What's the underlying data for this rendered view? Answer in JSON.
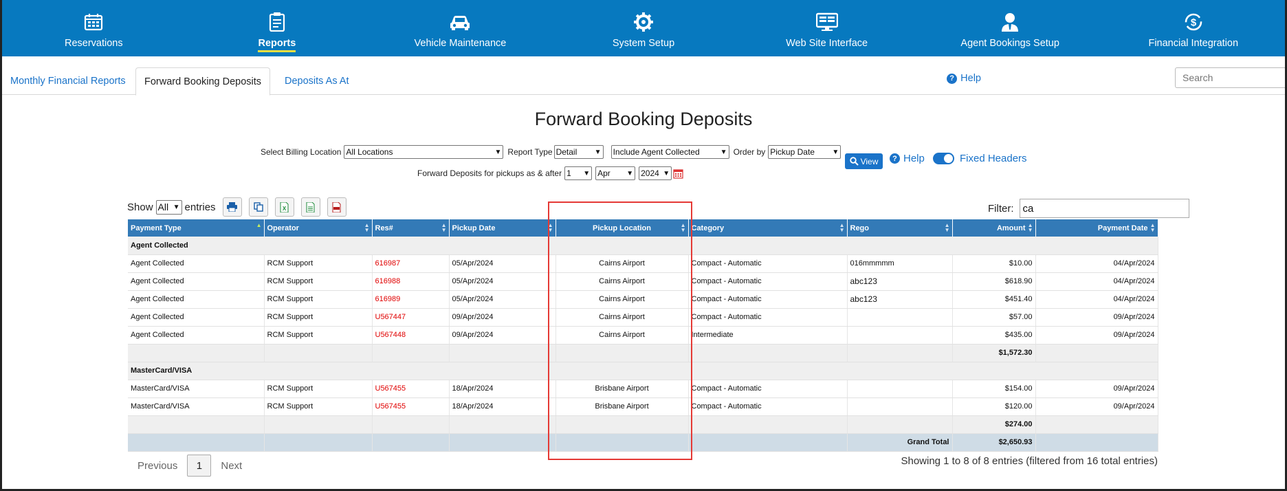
{
  "nav": [
    {
      "label": "Reservations",
      "icon": "calendar-icon",
      "active": false
    },
    {
      "label": "Reports",
      "icon": "report-icon",
      "active": true
    },
    {
      "label": "Vehicle Maintenance",
      "icon": "car-icon",
      "active": false
    },
    {
      "label": "System Setup",
      "icon": "gear-icon",
      "active": false
    },
    {
      "label": "Web Site Interface",
      "icon": "monitor-icon",
      "active": false
    },
    {
      "label": "Agent Bookings Setup",
      "icon": "agent-icon",
      "active": false
    },
    {
      "label": "Financial Integration",
      "icon": "dollar-cycle-icon",
      "active": false
    }
  ],
  "tabs": {
    "monthly": "Monthly Financial Reports",
    "forward": "Forward Booking Deposits",
    "asat": "Deposits As At"
  },
  "help_label": "Help",
  "search_placeholder": "Search",
  "title": "Forward Booking Deposits",
  "controls": {
    "billing_label": "Select Billing Location",
    "billing_value": "All Locations",
    "report_type_label": "Report Type",
    "report_type_value": "Detail",
    "agent_value": "Include Agent Collected",
    "order_label": "Order by",
    "order_value": "Pickup Date",
    "view_label": "View",
    "help_label": "Help",
    "fixed_headers_label": "Fixed Headers",
    "fixed_headers_on": true,
    "pickups_label": "Forward Deposits for pickups as & after",
    "day_value": "1",
    "month_value": "Apr",
    "year_value": "2024"
  },
  "table_tools": {
    "show_label": "Show",
    "show_value": "All",
    "entries_label": "entries",
    "filter_label": "Filter:",
    "filter_value": "ca"
  },
  "columns": [
    "Payment Type",
    "Operator",
    "Res#",
    "Pickup Date",
    "Pickup Location",
    "Category",
    "Rego",
    "Amount",
    "Payment Date"
  ],
  "groups": [
    {
      "name": "Agent Collected",
      "rows": [
        {
          "type": "Agent Collected",
          "operator": "RCM Support",
          "res": "616987",
          "pickup": "05/Apr/2024",
          "location": "Cairns Airport",
          "category": "Compact - Automatic",
          "rego": "016mmmmm",
          "amount": "$10.00",
          "paydate": "04/Apr/2024"
        },
        {
          "type": "Agent Collected",
          "operator": "RCM Support",
          "res": "616988",
          "pickup": "05/Apr/2024",
          "location": "Cairns Airport",
          "category": "Compact - Automatic",
          "rego": "abc123",
          "amount": "$618.90",
          "paydate": "04/Apr/2024"
        },
        {
          "type": "Agent Collected",
          "operator": "RCM Support",
          "res": "616989",
          "pickup": "05/Apr/2024",
          "location": "Cairns Airport",
          "category": "Compact - Automatic",
          "rego": "abc123",
          "amount": "$451.40",
          "paydate": "04/Apr/2024"
        },
        {
          "type": "Agent Collected",
          "operator": "RCM Support",
          "res": "U567447",
          "pickup": "09/Apr/2024",
          "location": "Cairns Airport",
          "category": "Compact - Automatic",
          "rego": "",
          "amount": "$57.00",
          "paydate": "09/Apr/2024"
        },
        {
          "type": "Agent Collected",
          "operator": "RCM Support",
          "res": "U567448",
          "pickup": "09/Apr/2024",
          "location": "Cairns Airport",
          "category": "Intermediate",
          "rego": "",
          "amount": "$435.00",
          "paydate": "09/Apr/2024"
        }
      ],
      "subtotal": "$1,572.30"
    },
    {
      "name": "MasterCard/VISA",
      "rows": [
        {
          "type": "MasterCard/VISA",
          "operator": "RCM Support",
          "res": "U567455",
          "pickup": "18/Apr/2024",
          "location": "Brisbane Airport",
          "category": "Compact - Automatic",
          "rego": "",
          "amount": "$154.00",
          "paydate": "09/Apr/2024"
        },
        {
          "type": "MasterCard/VISA",
          "operator": "RCM Support",
          "res": "U567455",
          "pickup": "18/Apr/2024",
          "location": "Brisbane Airport",
          "category": "Compact - Automatic",
          "rego": "",
          "amount": "$120.00",
          "paydate": "09/Apr/2024"
        }
      ],
      "subtotal": "$274.00"
    }
  ],
  "grand_total_label": "Grand Total",
  "grand_total": "$2,650.93",
  "pager": {
    "previous": "Previous",
    "page": "1",
    "next": "Next"
  },
  "info": "Showing 1 to 8 of 8 entries (filtered from 16 total entries)",
  "colors": {
    "nav_bg": "#0779bf",
    "accent": "#1a73c9",
    "header_bg": "#337ab7",
    "res_link": "#e00000",
    "highlight": "#e53935"
  }
}
